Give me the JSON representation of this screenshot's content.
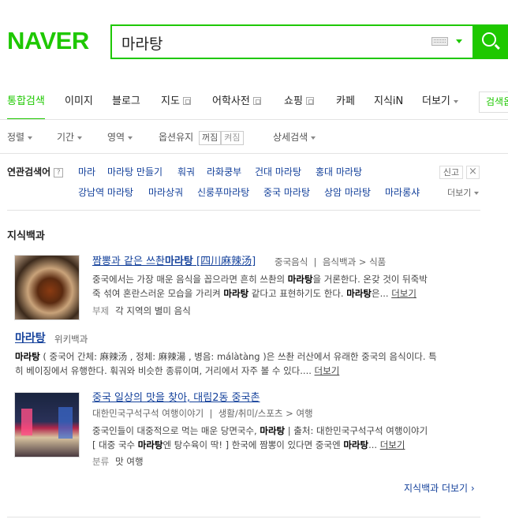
{
  "header": {
    "logo": "NAVER",
    "query": "마라탕",
    "brand_color": "#1ec800"
  },
  "tabs": [
    {
      "label": "통합검색",
      "active": true
    },
    {
      "label": "이미지"
    },
    {
      "label": "블로그"
    },
    {
      "label": "지도"
    },
    {
      "label": "어학사전"
    },
    {
      "label": "쇼핑"
    },
    {
      "label": "카페"
    },
    {
      "label": "지식iN"
    },
    {
      "label": "더보기"
    }
  ],
  "more_search_label": "검색옵",
  "options": {
    "sort": "정렬",
    "period": "기간",
    "area": "영역",
    "keep_label": "옵션유지",
    "off": "꺼짐",
    "on": "켜짐",
    "detail": "상세검색"
  },
  "related": {
    "label": "연관검색어",
    "help": "?",
    "items_row1": [
      "마라",
      "마라탕 만들기",
      "훠궈",
      "라화쿵부",
      "건대 마라탕",
      "홍대 마라탕"
    ],
    "items_row2": [
      "강남역 마라탕",
      "마라상궈",
      "신룽푸마라탕",
      "중국 마라탕",
      "상암 마라탕",
      "마라롱샤"
    ],
    "report": "신고",
    "close": "×",
    "more": "더보기"
  },
  "section": {
    "title": "지식백과",
    "results": [
      {
        "title_pre": "짬뽕과 같은 쓰촨",
        "title_bold": "마라탕",
        "title_post": " [四川麻辣汤]",
        "source": "중국음식",
        "category": "음식백과 > 식품",
        "desc_line1_pre": "중국에서는 가장 매운 음식을 꼽으라면 흔히 쓰촨의 ",
        "desc_line1_bold": "마라탕",
        "desc_line1_post": "을 거론한다. 온갖 것이 뒤죽박",
        "desc_line2_pre": "죽 섞여 혼란스러운 모습을 가리켜 ",
        "desc_line2_bold": "마라탕",
        "desc_line2_mid": " 같다고 표현하기도 한다. ",
        "desc_line2_bold2": "마라탕",
        "desc_line2_post": "은...",
        "more": "더보기",
        "sub_label": "부제",
        "sub_value": "각 지역의 별미 음식"
      },
      {
        "title": "마라탕",
        "source": "위키백과",
        "desc_line1_bold": "마라탕",
        "desc_line1_post": " ( 중국어 간체: 麻辣汤 , 정체: 麻辣湯 , 병음: málàtàng )은 쓰촨 러산에서 유래한 중국의 음식이다. 특",
        "desc_line2": "히 베이징에서 유행한다. 훠궈와 비슷한 종류이며, 거리에서 자주 볼 수 있다....",
        "more": "더보기"
      },
      {
        "title": "중국 일상의 맛을 찾아, 대림2동 중국촌",
        "source": "대한민국구석구석 여행이야기",
        "category": "생활/취미/스포츠 > 여행",
        "desc_line1_pre": "중국인들이 대중적으로 먹는 매운 당면국수, ",
        "desc_line1_bold": "마라탕",
        "desc_line1_post": " | 출처: 대한민국구석구석 여행이야기",
        "desc_line2_pre": "[ 대중 국수 ",
        "desc_line2_bold": "마라탕",
        "desc_line2_mid": "엔 탕수육이 딱! ] 한국에 짬뽕이 있다면 중국엔 ",
        "desc_line2_bold2": "마라탕",
        "desc_line2_post": "...",
        "more": "더보기",
        "sub_label": "분류",
        "sub_value": "맛 여행"
      }
    ],
    "more": "지식백과 더보기 ›"
  }
}
